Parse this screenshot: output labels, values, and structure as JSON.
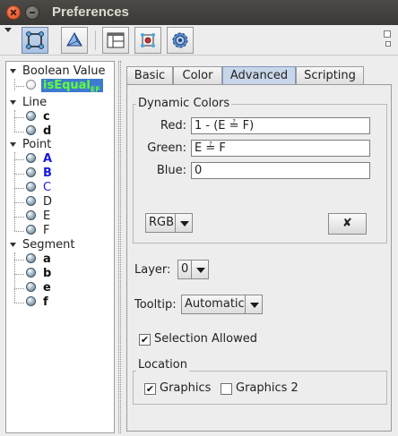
{
  "window": {
    "title": "Preferences"
  },
  "toolbar": {
    "buttons": [
      {
        "icon": "graphics-view-icon",
        "selected": true
      },
      {
        "icon": "graphics-3d-icon",
        "selected": false
      },
      {
        "icon": "layout-icon",
        "selected": false
      },
      {
        "icon": "defaults-icon",
        "selected": false
      },
      {
        "icon": "advanced-settings-icon",
        "selected": false
      }
    ]
  },
  "tree": {
    "groups": [
      {
        "label": "Boolean Value",
        "items": [
          {
            "name": "isEqual",
            "sub": "EF",
            "selected": true
          }
        ]
      },
      {
        "label": "Line",
        "items": [
          {
            "name": "c"
          },
          {
            "name": "d"
          }
        ]
      },
      {
        "label": "Point",
        "items": [
          {
            "name": "A"
          },
          {
            "name": "B"
          },
          {
            "name": "C"
          },
          {
            "name": "D"
          },
          {
            "name": "E"
          },
          {
            "name": "F"
          }
        ]
      },
      {
        "label": "Segment",
        "items": [
          {
            "name": "a"
          },
          {
            "name": "b"
          },
          {
            "name": "e"
          },
          {
            "name": "f"
          }
        ]
      }
    ]
  },
  "tabs": [
    {
      "label": "Basic",
      "active": false
    },
    {
      "label": "Color",
      "active": false
    },
    {
      "label": "Advanced",
      "active": true
    },
    {
      "label": "Scripting",
      "active": false
    }
  ],
  "dynamic_colors": {
    "legend": "Dynamic Colors",
    "red_label": "Red:",
    "red_value": "1 - (E ≟ F)",
    "green_label": "Green:",
    "green_value": "E ≟ F",
    "blue_label": "Blue:",
    "blue_value": "0",
    "mode_value": "RGB",
    "clear_button": "✘"
  },
  "layer": {
    "label": "Layer:",
    "value": "0"
  },
  "tooltip": {
    "label": "Tooltip:",
    "value": "Automatic"
  },
  "selection_allowed": {
    "label": "Selection Allowed",
    "checked": true
  },
  "location": {
    "legend": "Location",
    "graphics_label": "Graphics",
    "graphics_checked": true,
    "graphics2_label": "Graphics 2",
    "graphics2_checked": false
  }
}
